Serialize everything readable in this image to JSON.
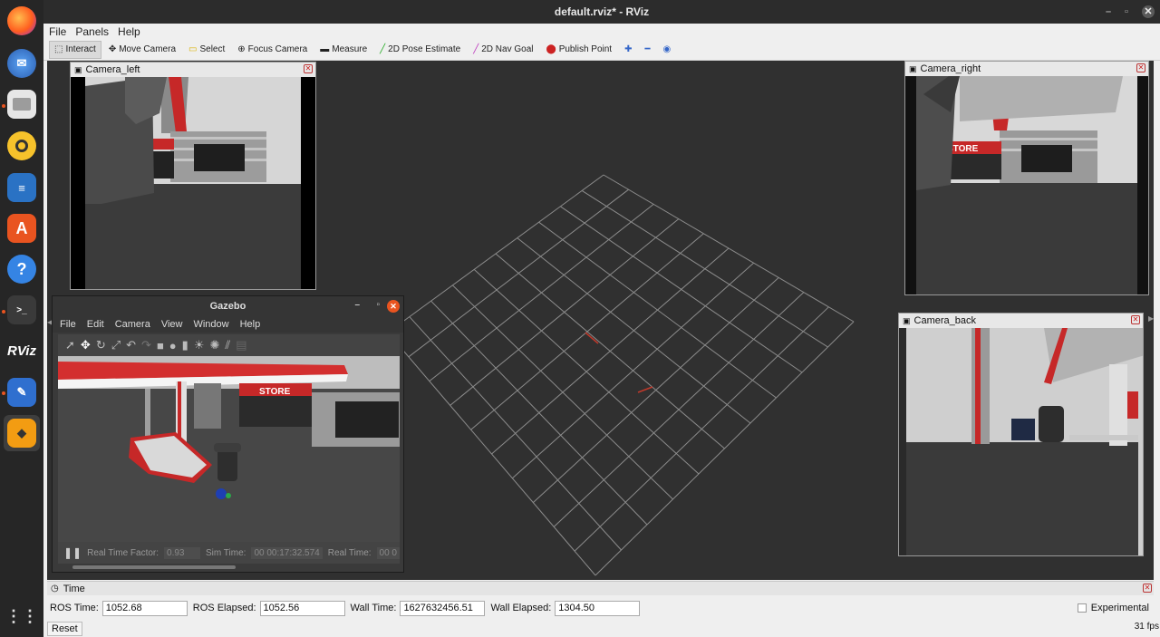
{
  "window": {
    "title": "default.rviz* - RViz"
  },
  "menubar": {
    "file": "File",
    "panels": "Panels",
    "help": "Help"
  },
  "toolbar": {
    "interact": "Interact",
    "move_camera": "Move Camera",
    "select": "Select",
    "focus_camera": "Focus Camera",
    "measure": "Measure",
    "pose_estimate": "2D Pose Estimate",
    "nav_goal": "2D Nav Goal",
    "publish_point": "Publish Point"
  },
  "panels": {
    "camera_left": "Camera_left",
    "camera_right": "Camera_right",
    "camera_back": "Camera_back"
  },
  "gazebo": {
    "title": "Gazebo",
    "menu": {
      "file": "File",
      "edit": "Edit",
      "camera": "Camera",
      "view": "View",
      "window": "Window",
      "help": "Help"
    },
    "store_sign": "STORE",
    "status": {
      "rtf_label": "Real Time Factor:",
      "rtf_value": "0.93",
      "sim_label": "Sim Time:",
      "sim_value": "00 00:17:32.574",
      "real_label": "Real Time:",
      "real_value": "00 0"
    }
  },
  "time_panel": {
    "title": "Time",
    "ros_time_label": "ROS Time:",
    "ros_time": "1052.68",
    "ros_elapsed_label": "ROS Elapsed:",
    "ros_elapsed": "1052.56",
    "wall_time_label": "Wall Time:",
    "wall_time": "1627632456.51",
    "wall_elapsed_label": "Wall Elapsed:",
    "wall_elapsed": "1304.50",
    "experimental": "Experimental",
    "reset": "Reset",
    "fps": "31 fps"
  },
  "camera_scene": {
    "store_sign": "STORE"
  },
  "dock": {
    "apps": [
      "firefox-icon",
      "thunderbird-icon",
      "files-icon",
      "rhythmbox-icon",
      "writer-icon",
      "software-icon",
      "help-icon",
      "terminal-icon",
      "rviz-icon",
      "text-editor-icon",
      "gazebo-icon"
    ],
    "rviz_label": "RViz"
  },
  "colors": {
    "accent": "#e95420",
    "grid": "#9a9a9a",
    "close": "#e95420"
  }
}
